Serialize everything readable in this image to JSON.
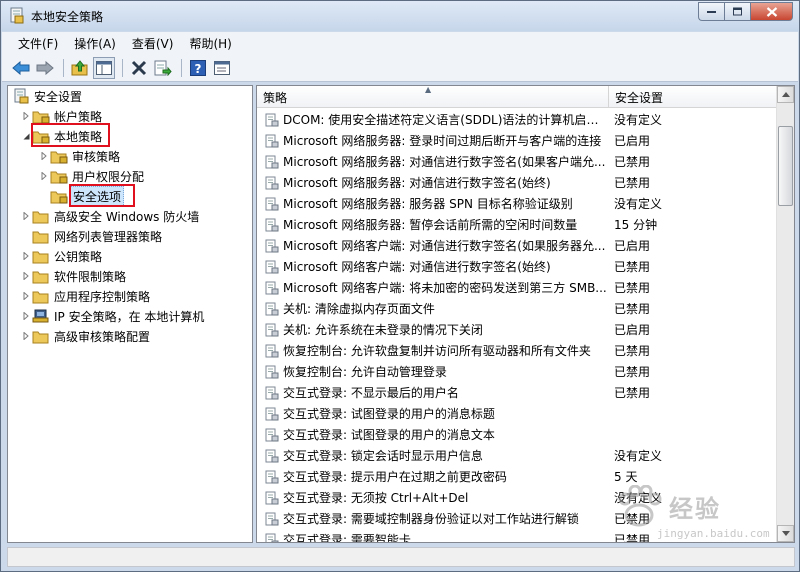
{
  "window": {
    "title": "本地安全策略"
  },
  "menu": [
    "文件(F)",
    "操作(A)",
    "查看(V)",
    "帮助(H)"
  ],
  "toolbar_icons": [
    "back-arrow-icon",
    "forward-arrow-icon",
    "up-folder-icon",
    "show-hide-tree-icon",
    "delete-icon",
    "export-list-icon",
    "help-icon",
    "properties-icon"
  ],
  "tree": [
    {
      "label": "安全设置",
      "level": 0,
      "icon": "security-settings-icon",
      "expander": "none"
    },
    {
      "label": "帐户策略",
      "level": 1,
      "icon": "folder-lock-icon",
      "expander": "collapsed"
    },
    {
      "label": "本地策略",
      "level": 1,
      "icon": "folder-lock-icon",
      "expander": "expanded",
      "highlight": true
    },
    {
      "label": "审核策略",
      "level": 2,
      "icon": "folder-lock-icon",
      "expander": "collapsed"
    },
    {
      "label": "用户权限分配",
      "level": 2,
      "icon": "folder-lock-icon",
      "expander": "collapsed"
    },
    {
      "label": "安全选项",
      "level": 2,
      "icon": "folder-lock-icon",
      "expander": "none",
      "selected": true,
      "highlight": true
    },
    {
      "label": "高级安全 Windows 防火墙",
      "level": 1,
      "icon": "folder-icon",
      "expander": "collapsed"
    },
    {
      "label": "网络列表管理器策略",
      "level": 1,
      "icon": "folder-icon",
      "expander": "none"
    },
    {
      "label": "公钥策略",
      "level": 1,
      "icon": "folder-icon",
      "expander": "collapsed"
    },
    {
      "label": "软件限制策略",
      "level": 1,
      "icon": "folder-icon",
      "expander": "collapsed"
    },
    {
      "label": "应用程序控制策略",
      "level": 1,
      "icon": "folder-icon",
      "expander": "collapsed"
    },
    {
      "label": "IP 安全策略，在 本地计算机",
      "level": 1,
      "icon": "ip-security-icon",
      "expander": "collapsed"
    },
    {
      "label": "高级审核策略配置",
      "level": 1,
      "icon": "folder-icon",
      "expander": "collapsed"
    }
  ],
  "list": {
    "columns": {
      "policy": "策略",
      "setting": "安全设置"
    },
    "rows": [
      {
        "policy": "DCOM: 使用安全描述符定义语言(SDDL)语法的计算机启动...",
        "setting": "没有定义"
      },
      {
        "policy": "Microsoft 网络服务器: 登录时间过期后断开与客户端的连接",
        "setting": "已启用"
      },
      {
        "policy": "Microsoft 网络服务器: 对通信进行数字签名(如果客户端允...",
        "setting": "已禁用"
      },
      {
        "policy": "Microsoft 网络服务器: 对通信进行数字签名(始终)",
        "setting": "已禁用"
      },
      {
        "policy": "Microsoft 网络服务器: 服务器 SPN 目标名称验证级别",
        "setting": "没有定义"
      },
      {
        "policy": "Microsoft 网络服务器: 暂停会话前所需的空闲时间数量",
        "setting": "15 分钟"
      },
      {
        "policy": "Microsoft 网络客户端: 对通信进行数字签名(如果服务器允...",
        "setting": "已启用"
      },
      {
        "policy": "Microsoft 网络客户端: 对通信进行数字签名(始终)",
        "setting": "已禁用"
      },
      {
        "policy": "Microsoft 网络客户端: 将未加密的密码发送到第三方 SMB...",
        "setting": "已禁用"
      },
      {
        "policy": "关机: 清除虚拟内存页面文件",
        "setting": "已禁用"
      },
      {
        "policy": "关机: 允许系统在未登录的情况下关闭",
        "setting": "已启用"
      },
      {
        "policy": "恢复控制台: 允许软盘复制并访问所有驱动器和所有文件夹",
        "setting": "已禁用"
      },
      {
        "policy": "恢复控制台: 允许自动管理登录",
        "setting": "已禁用"
      },
      {
        "policy": "交互式登录: 不显示最后的用户名",
        "setting": "已禁用"
      },
      {
        "policy": "交互式登录: 试图登录的用户的消息标题",
        "setting": ""
      },
      {
        "policy": "交互式登录: 试图登录的用户的消息文本",
        "setting": ""
      },
      {
        "policy": "交互式登录: 锁定会话时显示用户信息",
        "setting": "没有定义"
      },
      {
        "policy": "交互式登录: 提示用户在过期之前更改密码",
        "setting": "5 天"
      },
      {
        "policy": "交互式登录: 无须按 Ctrl+Alt+Del",
        "setting": "没有定义"
      },
      {
        "policy": "交互式登录: 需要域控制器身份验证以对工作站进行解锁",
        "setting": "已禁用"
      },
      {
        "policy": "交互式登录: 需要智能卡",
        "setting": "已禁用"
      }
    ]
  },
  "watermark": {
    "text": "经验",
    "url": "jingyan.baidu.com"
  }
}
